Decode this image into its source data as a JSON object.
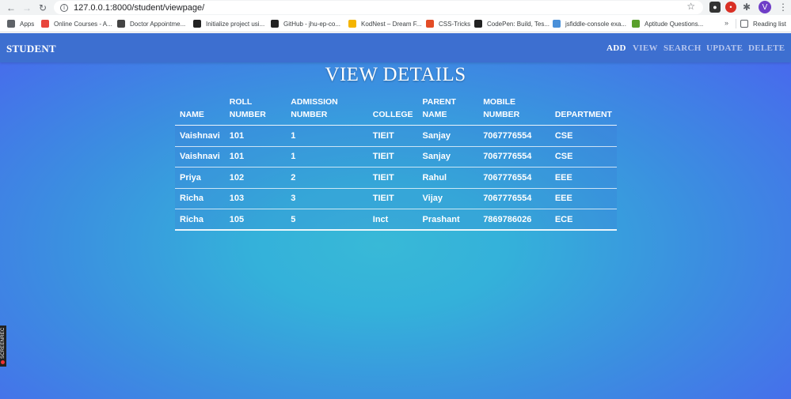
{
  "browser": {
    "url": "127.0.0.1:8000/student/viewpage/",
    "avatar_letter": "V",
    "bookmarks": [
      {
        "label": "Apps",
        "color": "#5f6368"
      },
      {
        "label": "Online Courses - A...",
        "color": "#e8453c"
      },
      {
        "label": "Doctor Appointme...",
        "color": "#444444"
      },
      {
        "label": "Initialize project usi...",
        "color": "#222222"
      },
      {
        "label": "GitHub - jhu-ep-co...",
        "color": "#222222"
      },
      {
        "label": "KodNest – Dream F...",
        "color": "#f4b400"
      },
      {
        "label": "CSS-Tricks",
        "color": "#e34c26"
      },
      {
        "label": "CodePen: Build, Tes...",
        "color": "#222222"
      },
      {
        "label": "jsfiddle-console exa...",
        "color": "#4a90d9"
      },
      {
        "label": "Aptitude Questions...",
        "color": "#5aa02c"
      }
    ],
    "more_label": "»",
    "reading_list_label": "Reading list"
  },
  "navbar": {
    "brand": "STUDENT",
    "links": [
      "ADD",
      "VIEW",
      "SEARCH",
      "UPDATE",
      "DELETE"
    ],
    "active_link": "ADD"
  },
  "page_title": "VIEW DETAILS",
  "table": {
    "headers": [
      [
        "NAME"
      ],
      [
        "ROLL",
        "NUMBER"
      ],
      [
        "ADMISSION",
        "NUMBER"
      ],
      [
        "COLLEGE"
      ],
      [
        "PARENT",
        "NAME"
      ],
      [
        "MOBILE",
        "NUMBER"
      ],
      [
        "DEPARTMENT"
      ]
    ],
    "rows": [
      [
        "Vaishnavi",
        "101",
        "1",
        "TIEIT",
        "Sanjay",
        "7067776554",
        "CSE"
      ],
      [
        "Vaishnavi",
        "101",
        "1",
        "TIEIT",
        "Sanjay",
        "7067776554",
        "CSE"
      ],
      [
        "Priya",
        "102",
        "2",
        "TIEIT",
        "Rahul",
        "7067776554",
        "EEE"
      ],
      [
        "Richa",
        "103",
        "3",
        "TIEIT",
        "Vijay",
        "7067776554",
        "EEE"
      ],
      [
        "Richa",
        "105",
        "5",
        "Inct",
        "Prashant",
        "7869786026",
        "ECE"
      ]
    ]
  },
  "screenrec_label": "SCREENREC",
  "colors": {
    "navbar": "#3d6fd0",
    "gradient_center": "#38b9d7",
    "gradient_edge": "#4a63ef"
  }
}
